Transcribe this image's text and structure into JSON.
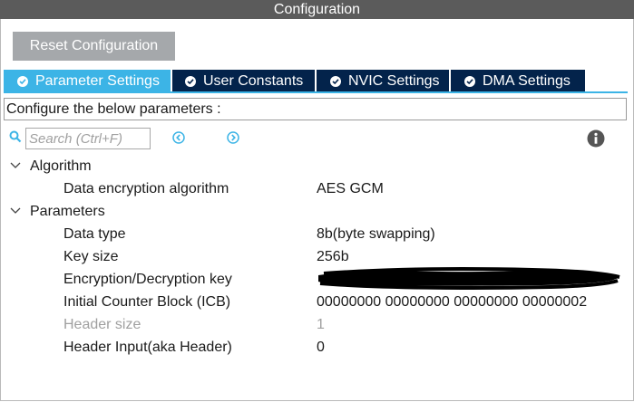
{
  "window": {
    "title": "Configuration"
  },
  "toolbar": {
    "reset_label": "Reset Configuration"
  },
  "tabs": [
    {
      "label": "Parameter Settings",
      "active": true,
      "icon": "check-circle-icon"
    },
    {
      "label": "User Constants",
      "active": false,
      "icon": "check-circle-icon"
    },
    {
      "label": "NVIC Settings",
      "active": false,
      "icon": "check-circle-icon"
    },
    {
      "label": "DMA Settings",
      "active": false,
      "icon": "check-circle-icon"
    }
  ],
  "hint": "Configure the below parameters :",
  "search": {
    "placeholder": "Search (Ctrl+F)",
    "value": ""
  },
  "groups": [
    {
      "label": "Algorithm",
      "items": [
        {
          "name": "Data encryption algorithm",
          "value": "AES GCM",
          "enabled": true
        }
      ]
    },
    {
      "label": "Parameters",
      "items": [
        {
          "name": "Data type",
          "value": "8b(byte swapping)",
          "enabled": true
        },
        {
          "name": "Key size",
          "value": "256b",
          "enabled": true
        },
        {
          "name": "Encryption/Decryption key",
          "value": "",
          "enabled": true
        },
        {
          "name": "Initial Counter Block (ICB)",
          "value": "00000000 00000000 00000000 00000002",
          "enabled": true
        },
        {
          "name": "Header size",
          "value": "1",
          "enabled": false
        },
        {
          "name": "Header Input(aka Header)",
          "value": "0",
          "enabled": true
        }
      ]
    }
  ],
  "colors": {
    "titlebar": "#5b5b5b",
    "tab_active": "#3cb4e6",
    "tab_inactive": "#03234b",
    "button": "#a5a8ab",
    "search_icon": "#3cb4e6",
    "disabled_text": "#a0a0a0"
  }
}
